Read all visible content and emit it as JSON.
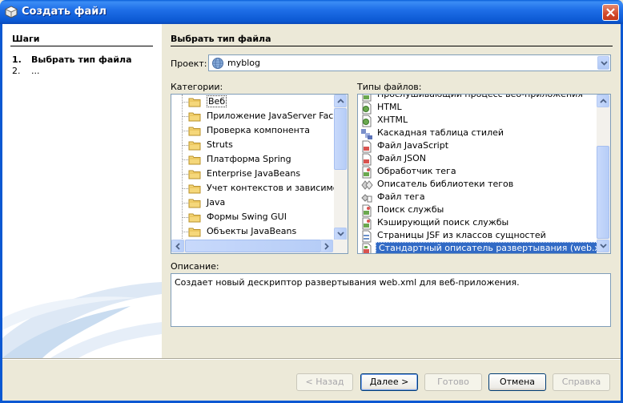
{
  "window": {
    "title": "Создать файл"
  },
  "steps": {
    "title": "Шаги",
    "items": [
      {
        "num": "1.",
        "label": "Выбрать тип файла"
      },
      {
        "num": "2.",
        "label": "..."
      }
    ]
  },
  "main": {
    "section_title": "Выбрать тип файла",
    "project_label": "Проект:",
    "project_value": "myblog",
    "categories_label": "Категории:",
    "types_label": "Типы файлов:",
    "categories": [
      "Веб",
      "Приложение JavaServer Faces",
      "Проверка компонента",
      "Struts",
      "Платформа Spring",
      "Enterprise JavaBeans",
      "Учет контекстов и зависимосте",
      "Java",
      "Формы Swing GUI",
      "Объекты JavaBeans"
    ],
    "selected_category": "Веб",
    "file_types": [
      "Прослушивающий процесс веб-приложения",
      "HTML",
      "XHTML",
      "Каскадная таблица стилей",
      "Файл JavaScript",
      "Файл JSON",
      "Обработчик тега",
      "Описатель библиотеки тегов",
      "Файл тега",
      "Поиск службы",
      "Кэширующий поиск службы",
      "Страницы JSF из классов сущностей",
      "Стандартный описатель развертывания (web.xml)"
    ],
    "selected_file_type": "Стандартный описатель развертывания (web.xml)",
    "description_label": "Описание:",
    "description_text": "Создает новый дескриптор развертывания web.xml для веб-приложения."
  },
  "buttons": {
    "back": "< Назад",
    "next": "Далее >",
    "finish": "Готово",
    "cancel": "Отмена",
    "help": "Справка"
  },
  "colors": {
    "titlebar": "#0b58d2",
    "selection": "#316ac5",
    "dialog_bg": "#ece9d8"
  }
}
